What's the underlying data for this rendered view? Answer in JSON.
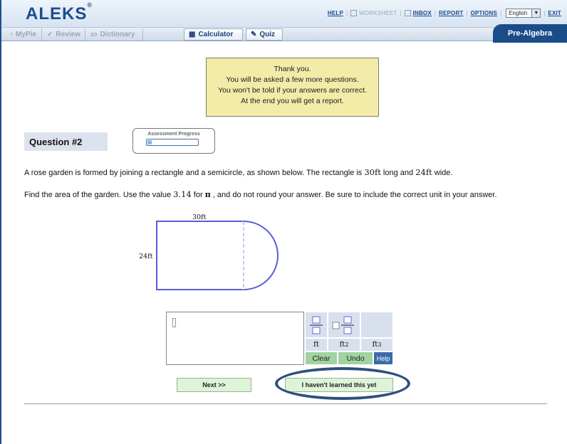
{
  "header": {
    "logo": "ALEKS",
    "logo_mark": "®",
    "links": {
      "help": "HELP",
      "worksheet": "WORKSHEET",
      "inbox": "INBOX",
      "report": "REPORT",
      "options": "OPTIONS",
      "exit": "EXIT"
    },
    "language": "English"
  },
  "tabs": {
    "mypie": "MyPie",
    "review": "Review",
    "dictionary": "Dictionary",
    "calculator": "Calculator",
    "quiz": "Quiz"
  },
  "course": "Pre-Algebra",
  "notice": {
    "line1": "Thank you.",
    "line2": "You will be asked a few more questions.",
    "line3": "You won't be told if your answers are correct.",
    "line4": "At the end you will get a report."
  },
  "question": {
    "label": "Question #2",
    "progress_title": "Assessment Progress",
    "progress_fraction": 0.08,
    "line1_a": "A rose garden is formed by joining a rectangle and a semicircle, as shown below. The rectangle is ",
    "length": "30",
    "unit": "ft",
    "line1_b": " long and ",
    "width": "24",
    "line1_c": " wide.",
    "line2_a": "Find the area of the garden. Use the value ",
    "pi_value": "3.14",
    "line2_b": " for ",
    "pi_symbol": "π",
    "line2_c": " , and do not round your answer. Be sure to include the correct unit in your answer."
  },
  "figure": {
    "top_label": "30ft",
    "side_label": "24ft"
  },
  "keypad": {
    "ft": "ft",
    "ft2_base": "ft",
    "ft2_exp": "2",
    "ft3_base": "ft",
    "ft3_exp": "3",
    "clear": "Clear",
    "undo": "Undo",
    "help": "Help"
  },
  "buttons": {
    "next": "Next >>",
    "not_learned": "I haven't learned this yet"
  },
  "colors": {
    "brand": "#1c4c8c",
    "notice_bg": "#f3eca9",
    "figure_stroke": "#5b5bd6",
    "key_green": "#9fd39f",
    "highlight": "#2e4f7e"
  }
}
